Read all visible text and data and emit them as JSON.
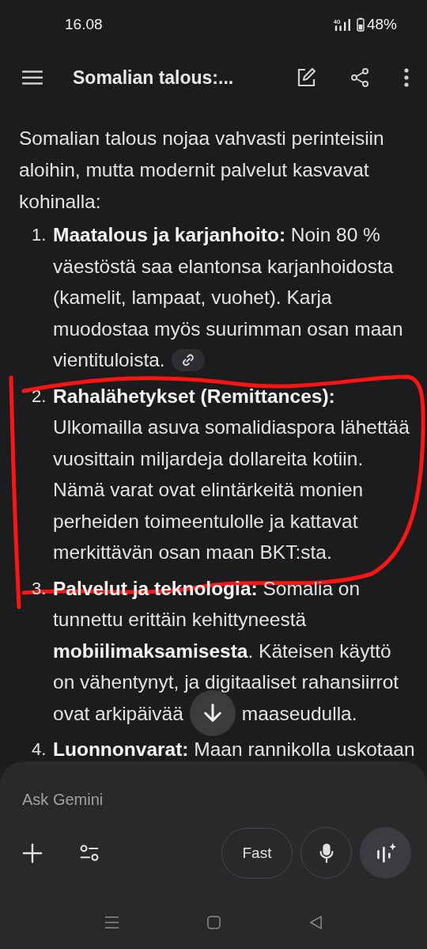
{
  "status_bar": {
    "time": "16.08",
    "network": "4G",
    "battery": "48%"
  },
  "top_bar": {
    "title": "Somalian talous:..."
  },
  "intro": "Somalian talous nojaa vahvasti perinteisiin aloihin, mutta modernit palvelut kasvavat kohinalla:",
  "items": [
    {
      "number": "1.",
      "text": "**Maatalous ja karjanhoito:** Noin 80 % väestöstä saa elantonsa karjanhoidosta (kamelit, lampaat, vuohet). Karja muodostaa myös suurimman osan maan",
      "last_line": "vientituloista.",
      "source_link": true,
      "circled": false
    },
    {
      "number": "2.",
      "text": "**Rahalähetykset (Remittances):** Ulkomailla asuva somalidiaspora lähettää vuosittain miljardeja dollareita kotiin. Nämä varat ovat elintärkeitä monien perheiden toimeentulolle ja kattavat merkittävän osan maan BKT:sta.",
      "source_link": false,
      "circled": true
    },
    {
      "number": "3.",
      "text": "**Palvelut ja teknologia:** Somalia on tunnettu erittäin kehittyneestä **mobiilimaksamisesta**. Käteisen käyttö on vähentynyt, ja digitaaliset rahansiirrot",
      "last_line": "ovat arkipäivää",
      "after_scroll_button": "maaseudulla.",
      "source_link": false,
      "circled": false
    },
    {
      "number": "4.",
      "text": "**Luonnonvarat:** Maan rannikolla uskotaan",
      "source_link": false,
      "circled": false
    }
  ],
  "composer": {
    "placeholder": "Ask Gemini",
    "mode_button": "Fast"
  }
}
